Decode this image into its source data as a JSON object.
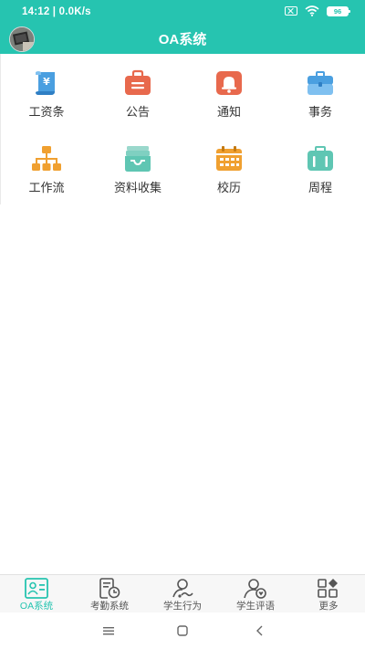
{
  "status_bar": {
    "time_speed": "14:12 | 0.0K/s",
    "battery": "96",
    "icons": [
      "sim-off-icon",
      "wifi-icon",
      "battery-icon"
    ]
  },
  "header": {
    "title": "OA系统",
    "avatar_icon": "avatar"
  },
  "colors": {
    "accent": "#26c4b0",
    "blue": "#4a9fe0",
    "red": "#e8694d",
    "orange": "#f0a030",
    "teal": "#5fc6b3"
  },
  "grid": {
    "items": [
      {
        "label": "工资条",
        "icon": "payslip-icon"
      },
      {
        "label": "公告",
        "icon": "announcement-icon"
      },
      {
        "label": "通知",
        "icon": "notification-bell-icon"
      },
      {
        "label": "事务",
        "icon": "briefcase-icon"
      },
      {
        "label": "工作流",
        "icon": "workflow-icon"
      },
      {
        "label": "资料收集",
        "icon": "inbox-tray-icon"
      },
      {
        "label": "校历",
        "icon": "calendar-icon"
      },
      {
        "label": "周程",
        "icon": "weekly-schedule-icon"
      }
    ]
  },
  "tabbar": {
    "tabs": [
      {
        "label": "OA系统",
        "icon": "oa-contact-card-icon",
        "active": true
      },
      {
        "label": "考勤系统",
        "icon": "attendance-clock-icon",
        "active": false
      },
      {
        "label": "学生行为",
        "icon": "student-behavior-icon",
        "active": false
      },
      {
        "label": "学生评语",
        "icon": "student-comment-icon",
        "active": false
      },
      {
        "label": "更多",
        "icon": "more-grid-icon",
        "active": false
      }
    ]
  },
  "navbar": {
    "buttons": [
      "menu-icon",
      "home-icon",
      "back-icon"
    ]
  }
}
